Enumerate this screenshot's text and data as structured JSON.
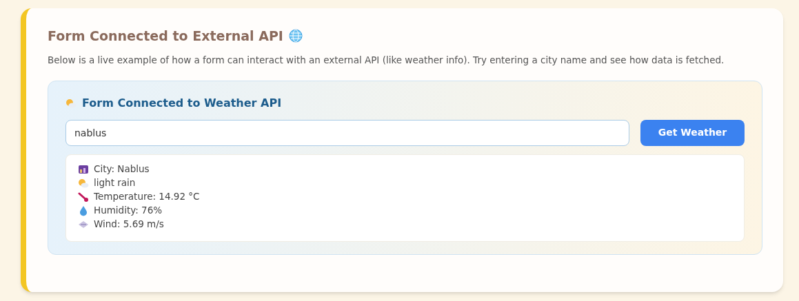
{
  "card": {
    "title": "Form Connected to External API",
    "description": "Below is a live example of how a form can interact with an external API (like weather info). Try entering a city name and see how data is fetched."
  },
  "form": {
    "heading": "Form Connected to Weather API",
    "city_input": {
      "value": "nablus"
    },
    "submit_button": "Get Weather",
    "results": [
      {
        "kind": "city",
        "text": "City: Nablus"
      },
      {
        "kind": "condition",
        "text": "light rain"
      },
      {
        "kind": "temperature",
        "text": "Temperature: 14.92 °C"
      },
      {
        "kind": "humidity",
        "text": "Humidity: 76%"
      },
      {
        "kind": "wind",
        "text": "Wind: 5.69 m/s"
      }
    ]
  }
}
